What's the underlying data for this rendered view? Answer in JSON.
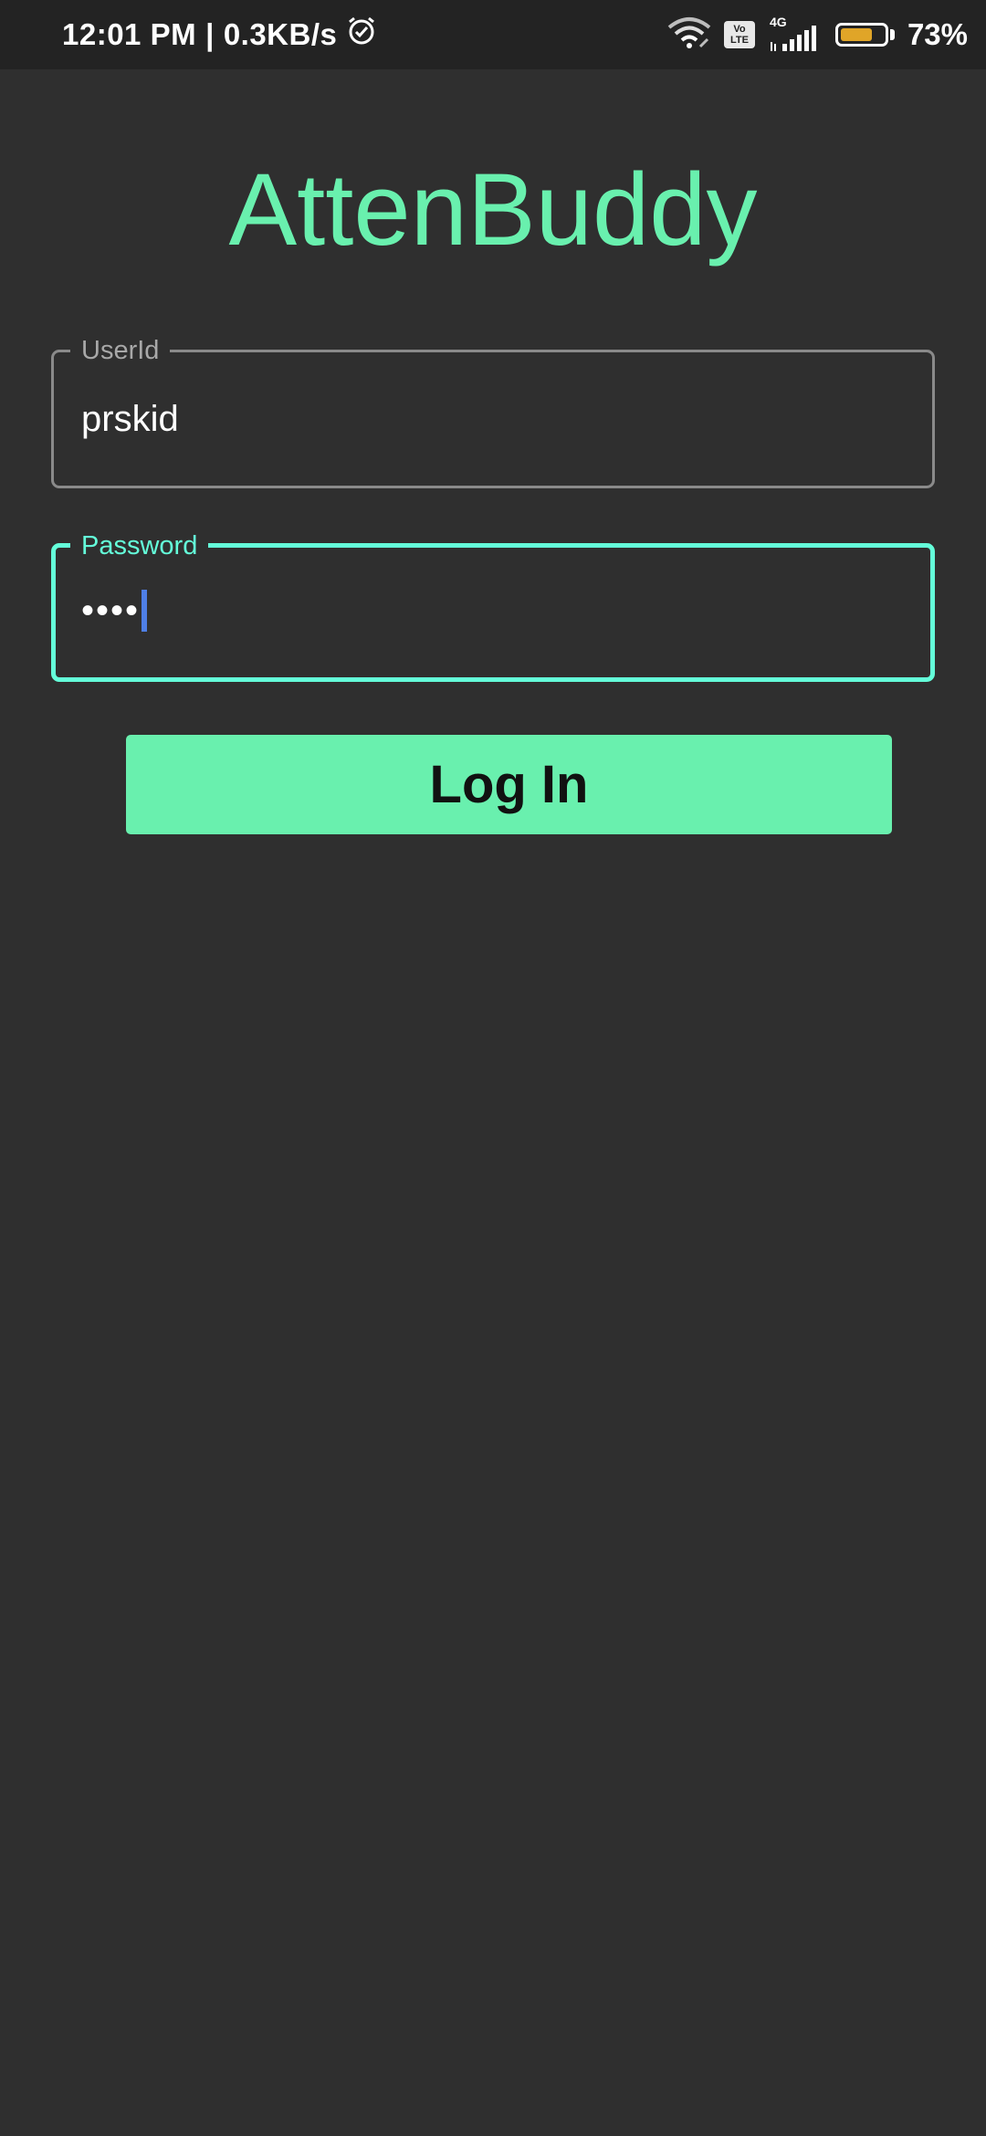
{
  "status_bar": {
    "time": "12:01 PM",
    "separator": "|",
    "speed": "0.3KB/s",
    "network_type": "4G",
    "volte_top": "Vo",
    "volte_bottom": "LTE",
    "battery_percent": "73%",
    "battery_level": 0.73,
    "battery_color": "#e0a528",
    "icons": [
      "alarm-icon",
      "wifi-icon",
      "volte-icon",
      "signal-icon",
      "battery-icon"
    ]
  },
  "app": {
    "title": "AttenBuddy",
    "accent_color": "#69f0ae"
  },
  "form": {
    "userid": {
      "label": "UserId",
      "value": "prskid"
    },
    "password": {
      "label": "Password",
      "masked_value": "••••",
      "focused": true
    },
    "login_label": "Log In"
  }
}
